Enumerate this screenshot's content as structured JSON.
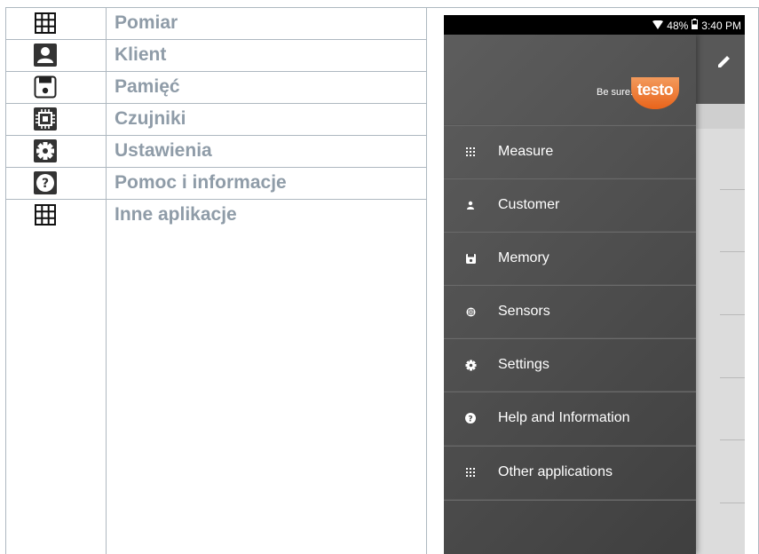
{
  "legend": {
    "items": [
      {
        "icon": "grid-icon",
        "label": "Pomiar"
      },
      {
        "icon": "person-icon",
        "label": "Klient"
      },
      {
        "icon": "floppy-disk-icon",
        "label": "Pamięć"
      },
      {
        "icon": "chip-icon",
        "label": "Czujniki"
      },
      {
        "icon": "gear-icon",
        "label": "Ustawienia"
      },
      {
        "icon": "help-icon",
        "label": "Pomoc i informacje"
      },
      {
        "icon": "grid-icon",
        "label": "Inne aplikacje"
      }
    ]
  },
  "phone": {
    "status_bar": {
      "battery": "48%",
      "time": "3:40 PM"
    },
    "drawer": {
      "tagline": "Be sure.",
      "brand": "testo",
      "items": [
        {
          "icon": "dots-grid-icon",
          "label": "Measure"
        },
        {
          "icon": "person-icon",
          "label": "Customer"
        },
        {
          "icon": "floppy-disk-icon",
          "label": "Memory"
        },
        {
          "icon": "sensor-icon",
          "label": "Sensors"
        },
        {
          "icon": "gear-icon",
          "label": "Settings"
        },
        {
          "icon": "help-icon",
          "label": "Help and Information"
        },
        {
          "icon": "dots-grid-icon",
          "label": "Other applications"
        }
      ]
    },
    "app_bar": {
      "edit_icon": "pencil-icon"
    }
  },
  "colors": {
    "legend_text": "#8f9ca8",
    "table_border": "#aeb8c0",
    "brand_orange": "#e8641b",
    "drawer_bg": "#4a4a4a"
  }
}
